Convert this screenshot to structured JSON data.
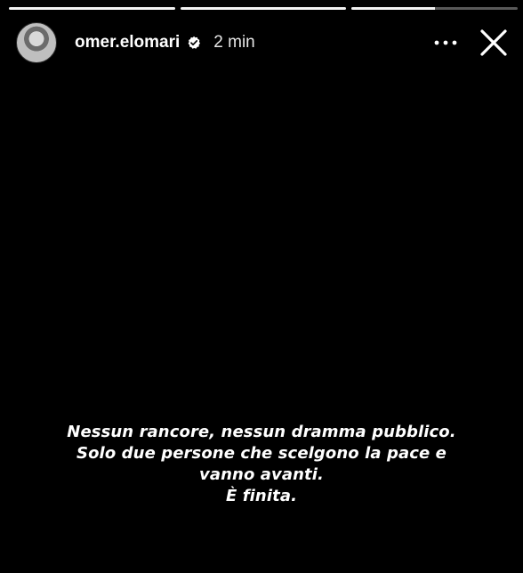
{
  "progress": [
    1,
    1,
    0.5
  ],
  "header": {
    "username": "omer.elomari",
    "time": "2 min"
  },
  "icons": {
    "avatar": "profile-photo",
    "verified": "verified-badge-icon",
    "more": "more-options-icon",
    "close": "close-icon"
  },
  "caption": {
    "line1": "Nessun rancore, nessun dramma pubblico.",
    "line2": "Solo due persone che scelgono la pace e",
    "line3": "vanno avanti.",
    "line4": "È finita."
  }
}
